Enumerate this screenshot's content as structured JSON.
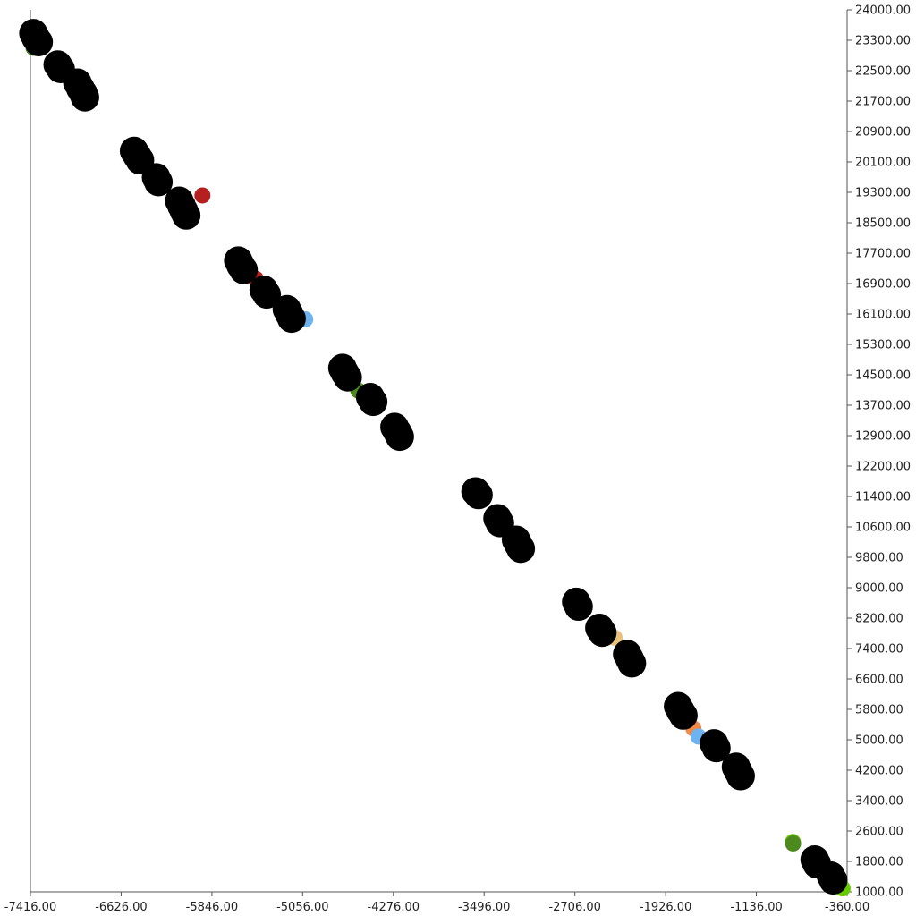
{
  "chart_data": {
    "type": "scatter",
    "title": "",
    "xlabel": "",
    "ylabel": "",
    "xlim": [
      -7416,
      -360
    ],
    "ylim": [
      1000,
      24000
    ],
    "y_axis_side": "right",
    "grid": false,
    "legend": "none",
    "x_ticks": [
      "-7416.00",
      "-6626.00",
      "-5846.00",
      "-5056.00",
      "-4276.00",
      "-3496.00",
      "-2706.00",
      "-1926.00",
      "-1136.00",
      "-360.00"
    ],
    "y_ticks": [
      "24000.00",
      "23300.00",
      "22500.00",
      "21700.00",
      "20900.00",
      "20100.00",
      "19300.00",
      "18500.00",
      "17700.00",
      "16900.00",
      "16100.00",
      "15300.00",
      "14500.00",
      "13700.00",
      "12900.00",
      "12200.00",
      "11400.00",
      "10600.00",
      "9800.00",
      "9000.00",
      "8200.00",
      "7400.00",
      "6600.00",
      "5800.00",
      "5000.00",
      "4200.00",
      "3400.00",
      "2600.00",
      "1800.00",
      "1000.00"
    ],
    "colored_points": [
      {
        "x": -7389,
        "y": 23010,
        "color": "#4d8a1e"
      },
      {
        "x": -6954,
        "y": 21610,
        "color": "#6fb2f0"
      },
      {
        "x": -5930,
        "y": 19160,
        "color": "#b51f1f"
      },
      {
        "x": -5470,
        "y": 16990,
        "color": "#b51f1f"
      },
      {
        "x": -5042,
        "y": 15930,
        "color": "#6fb2f0"
      },
      {
        "x": -4583,
        "y": 14070,
        "color": "#4d8a1e"
      },
      {
        "x": -4194,
        "y": 12880,
        "color": "#f08a4b"
      },
      {
        "x": -3581,
        "y": 11580,
        "color": "#b51f1f"
      },
      {
        "x": -3314,
        "y": 10500,
        "color": "#555555"
      },
      {
        "x": -2708,
        "y": 8720,
        "color": "#4d8a1e"
      },
      {
        "x": -2369,
        "y": 7630,
        "color": "#e8c27a"
      },
      {
        "x": -1688,
        "y": 5260,
        "color": "#f08a4b"
      },
      {
        "x": -1644,
        "y": 5050,
        "color": "#6fb2f0"
      },
      {
        "x": -829,
        "y": 2300,
        "color": "#66cc00"
      },
      {
        "x": -827,
        "y": 2260,
        "color": "#4d8a1e"
      },
      {
        "x": -399,
        "y": 1090,
        "color": "#66cc00"
      }
    ],
    "black_points": [
      {
        "x": -7390,
        "y": 23390
      },
      {
        "x": -7370,
        "y": 23270
      },
      {
        "x": -7345,
        "y": 23160
      },
      {
        "x": -7180,
        "y": 22570
      },
      {
        "x": -7155,
        "y": 22460
      },
      {
        "x": -7010,
        "y": 22100
      },
      {
        "x": -6985,
        "y": 21960
      },
      {
        "x": -6960,
        "y": 21830
      },
      {
        "x": -6945,
        "y": 21720
      },
      {
        "x": -6520,
        "y": 20320
      },
      {
        "x": -6495,
        "y": 20200
      },
      {
        "x": -6470,
        "y": 20080
      },
      {
        "x": -6330,
        "y": 19630
      },
      {
        "x": -6310,
        "y": 19510
      },
      {
        "x": -6130,
        "y": 19020
      },
      {
        "x": -6110,
        "y": 18890
      },
      {
        "x": -6090,
        "y": 18760
      },
      {
        "x": -6070,
        "y": 18640
      },
      {
        "x": -5620,
        "y": 17460
      },
      {
        "x": -5600,
        "y": 17340
      },
      {
        "x": -5575,
        "y": 17220
      },
      {
        "x": -5400,
        "y": 16700
      },
      {
        "x": -5375,
        "y": 16580
      },
      {
        "x": -5200,
        "y": 16190
      },
      {
        "x": -5180,
        "y": 16070
      },
      {
        "x": -5160,
        "y": 15950
      },
      {
        "x": -4720,
        "y": 14660
      },
      {
        "x": -4700,
        "y": 14540
      },
      {
        "x": -4675,
        "y": 14420
      },
      {
        "x": -4480,
        "y": 13900
      },
      {
        "x": -4455,
        "y": 13780
      },
      {
        "x": -4270,
        "y": 13120
      },
      {
        "x": -4245,
        "y": 12990
      },
      {
        "x": -4225,
        "y": 12870
      },
      {
        "x": -3570,
        "y": 11440
      },
      {
        "x": -3545,
        "y": 11350
      },
      {
        "x": -3380,
        "y": 10740
      },
      {
        "x": -3360,
        "y": 10620
      },
      {
        "x": -3220,
        "y": 10180
      },
      {
        "x": -3200,
        "y": 10060
      },
      {
        "x": -3180,
        "y": 9950
      },
      {
        "x": -2700,
        "y": 8560
      },
      {
        "x": -2680,
        "y": 8440
      },
      {
        "x": -2500,
        "y": 7880
      },
      {
        "x": -2475,
        "y": 7760
      },
      {
        "x": -2260,
        "y": 7200
      },
      {
        "x": -2240,
        "y": 7080
      },
      {
        "x": -2220,
        "y": 6960
      },
      {
        "x": -1820,
        "y": 5840
      },
      {
        "x": -1800,
        "y": 5720
      },
      {
        "x": -1775,
        "y": 5600
      },
      {
        "x": -1510,
        "y": 4870
      },
      {
        "x": -1490,
        "y": 4750
      },
      {
        "x": -1320,
        "y": 4260
      },
      {
        "x": -1300,
        "y": 4140
      },
      {
        "x": -1280,
        "y": 4020
      },
      {
        "x": -640,
        "y": 1840
      },
      {
        "x": -620,
        "y": 1720
      },
      {
        "x": -500,
        "y": 1420
      },
      {
        "x": -480,
        "y": 1300
      }
    ]
  }
}
